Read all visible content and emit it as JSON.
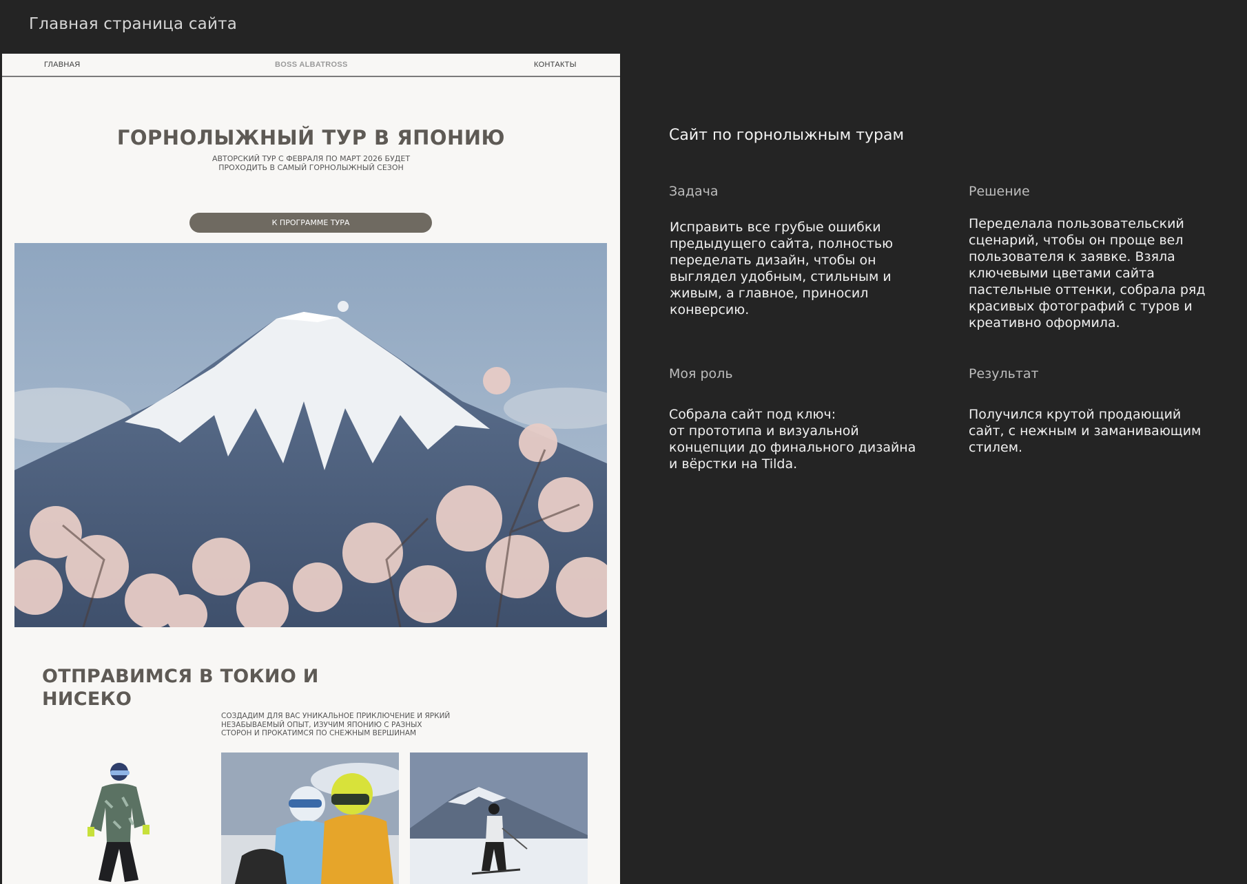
{
  "frame": {
    "title": "Главная страница сайта"
  },
  "site": {
    "nav": {
      "home": "ГЛАВНАЯ",
      "brand": "BOSS ALBATROSS",
      "contacts": "КОНТАКТЫ"
    },
    "hero": {
      "title": "ГОРНОЛЫЖНЫЙ ТУР В ЯПОНИЮ",
      "subtitle": "АВТОРСКИЙ ТУР С ФЕВРАЛЯ ПО МАРТ 2026 БУДЕТ\nПРОХОДИТЬ В САМЫЙ ГОРНОЛЫЖНЫЙ СЕЗОН",
      "button": "К ПРОГРАММЕ ТУРА"
    },
    "section": {
      "title": "ОТПРАВИМСЯ В ТОКИО И\nНИСЕКО",
      "subtitle": "СОЗДАДИМ ДЛЯ ВАС УНИКАЛЬНОЕ ПРИКЛЮЧЕНИЕ И ЯРКИЙ\nНЕЗАБЫВАЕМЫЙ ОПЫТ, ИЗУЧИМ ЯПОНИЮ С РАЗНЫХ\nСТОРОН И ПРОКАТИМСЯ ПО СНЕЖНЫМ ВЕРШИНАМ"
    }
  },
  "case": {
    "title": "Сайт по горнолыжным турам",
    "task": {
      "label": "Задача",
      "text": "Исправить все грубые ошибки\nпредыдущего сайта, полностью\nпеределать дизайн, чтобы он\nвыглядел удобным, стильным и\nживым, а главное, приносил\nконверсию."
    },
    "solution": {
      "label": "Решение",
      "text": "Переделала пользовательский\nсценарий, чтобы он проще вел\nпользователя к заявке. Взяла\nключевыми цветами сайта\nпастельные оттенки, собрала ряд\nкрасивых фотографий с туров и\nкреативно оформила."
    },
    "role": {
      "label": "Моя роль",
      "text": "Собрала сайт под ключ:\nот прототипа и визуальной\nконцепции до финального дизайна\nи вёрстки на Tilda."
    },
    "result": {
      "label": "Результат",
      "text": "Получился крутой продающий\nсайт, с нежным и заманивающим\nстилем."
    }
  },
  "colors": {
    "canvas": "#242424",
    "site_bg": "#f8f7f5",
    "accent_text": "#5e5a55",
    "button": "#6f6a61"
  }
}
